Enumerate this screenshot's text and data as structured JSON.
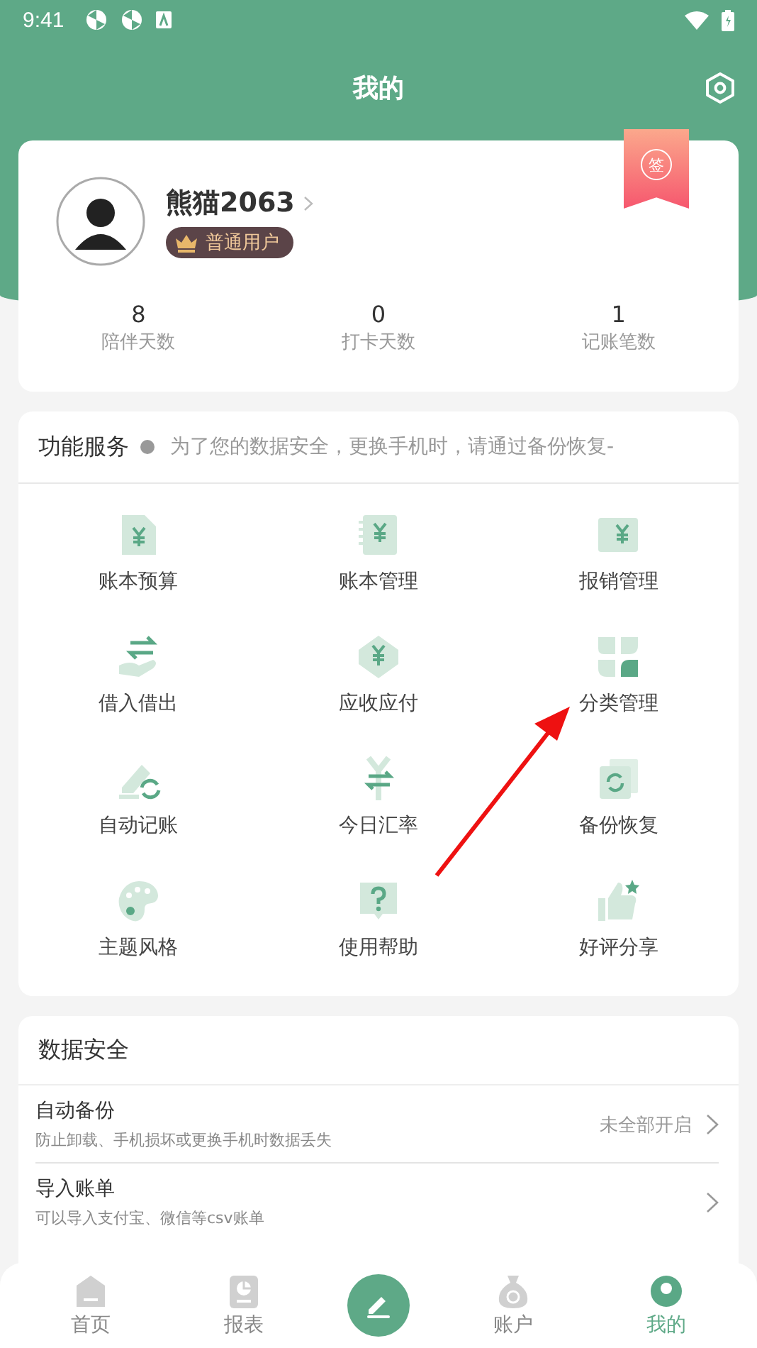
{
  "status_bar": {
    "time": "9:41"
  },
  "header": {
    "title": "我的"
  },
  "profile": {
    "name": "熊猫2063",
    "badge": "普通用户",
    "sign_in": "签",
    "stats": [
      {
        "value": "8",
        "label": "陪伴天数"
      },
      {
        "value": "0",
        "label": "打卡天数"
      },
      {
        "value": "1",
        "label": "记账笔数"
      }
    ]
  },
  "services": {
    "title": "功能服务",
    "notice": "为了您的数据安全，更换手机时，请通过备份恢复-",
    "items": [
      "账本预算",
      "账本管理",
      "报销管理",
      "借入借出",
      "应收应付",
      "分类管理",
      "自动记账",
      "今日汇率",
      "备份恢复",
      "主题风格",
      "使用帮助",
      "好评分享"
    ]
  },
  "data_security": {
    "title": "数据安全",
    "rows": [
      {
        "title": "自动备份",
        "subtitle": "防止卸载、手机损坏或更换手机时数据丢失",
        "value": "未全部开启"
      },
      {
        "title": "导入账单",
        "subtitle": "可以导入支付宝、微信等csv账单"
      }
    ]
  },
  "bottom_nav": [
    {
      "label": "首页",
      "selected": false
    },
    {
      "label": "报表",
      "selected": false
    },
    {
      "label": "账户",
      "selected": false
    },
    {
      "label": "我的",
      "selected": true
    }
  ]
}
